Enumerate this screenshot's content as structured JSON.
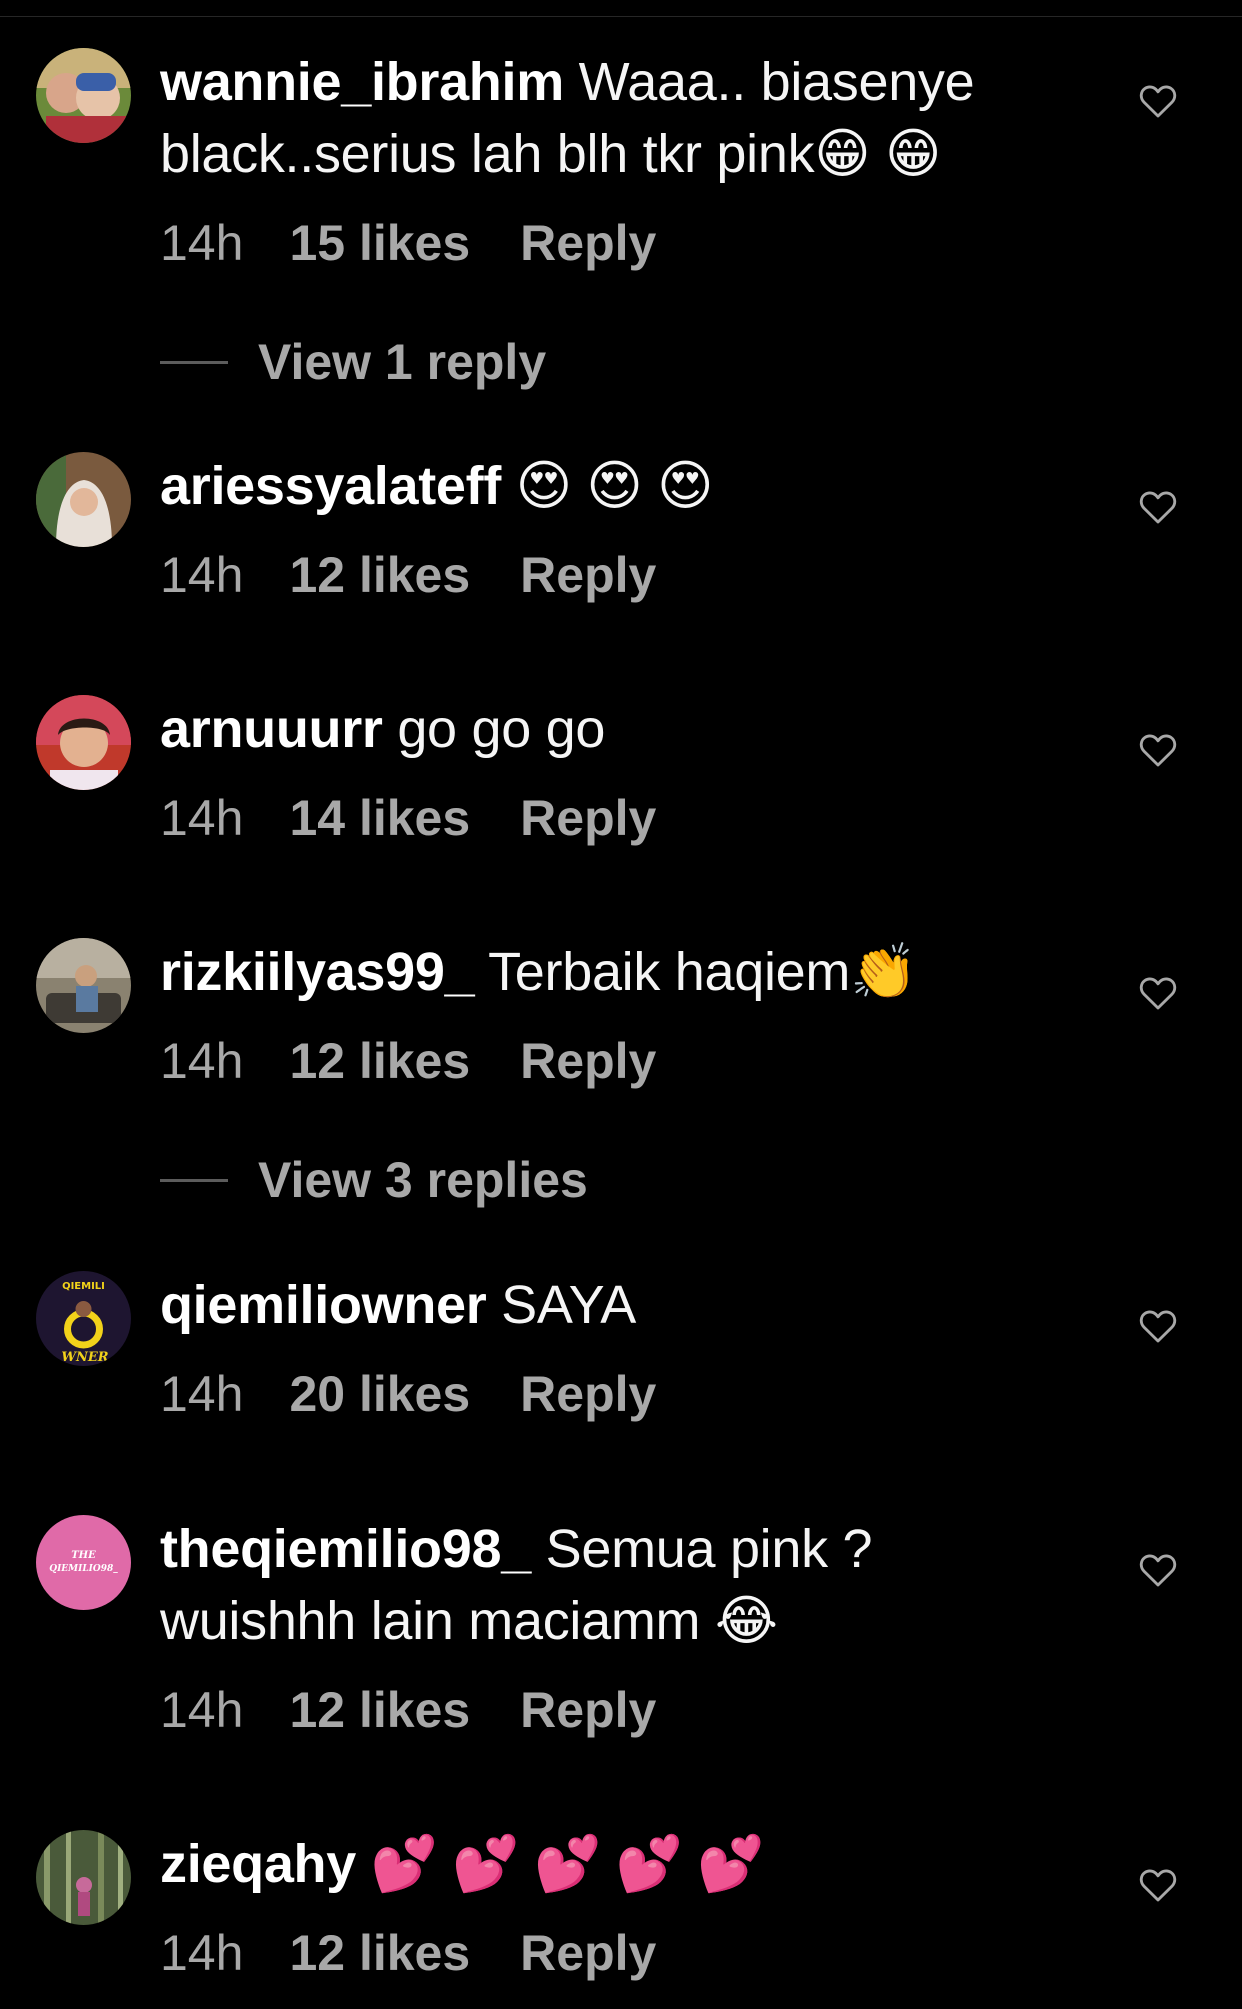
{
  "theme": {
    "background": "#000000",
    "text_primary": "#ffffff",
    "text_secondary": "#a8a8a8"
  },
  "comments": [
    {
      "username": "wannie_ibrahim",
      "text": "Waaa.. biasenye black..serius lah blh tkr pink😁 😁",
      "time": "14h",
      "likes": "15 likes",
      "reply_label": "Reply",
      "view_replies": "View 1 reply"
    },
    {
      "username": "ariessyalateff",
      "text": "😍 😍 😍",
      "time": "14h",
      "likes": "12 likes",
      "reply_label": "Reply"
    },
    {
      "username": "arnuuurr",
      "text": "go go go",
      "time": "14h",
      "likes": "14 likes",
      "reply_label": "Reply"
    },
    {
      "username": "rizkiilyas99_",
      "text": "Terbaik haqiem👏",
      "time": "14h",
      "likes": "12 likes",
      "reply_label": "Reply",
      "view_replies": "View 3 replies"
    },
    {
      "username": "qiemiliowner",
      "text": "SAYA",
      "time": "14h",
      "likes": "20 likes",
      "reply_label": "Reply",
      "avatar_text_top": "QIEMILI",
      "avatar_text_bottom": "WNER"
    },
    {
      "username": "theqiemilio98_",
      "text": "Semua pink ? wuishhh lain maciamm 😂",
      "time": "14h",
      "likes": "12 likes",
      "reply_label": "Reply",
      "avatar_text_top": "THE",
      "avatar_text_bottom": "QIEMILIO98_"
    },
    {
      "username": "zieqahy",
      "text": "💕 💕 💕 💕 💕",
      "time": "14h",
      "likes": "12 likes",
      "reply_label": "Reply"
    }
  ]
}
